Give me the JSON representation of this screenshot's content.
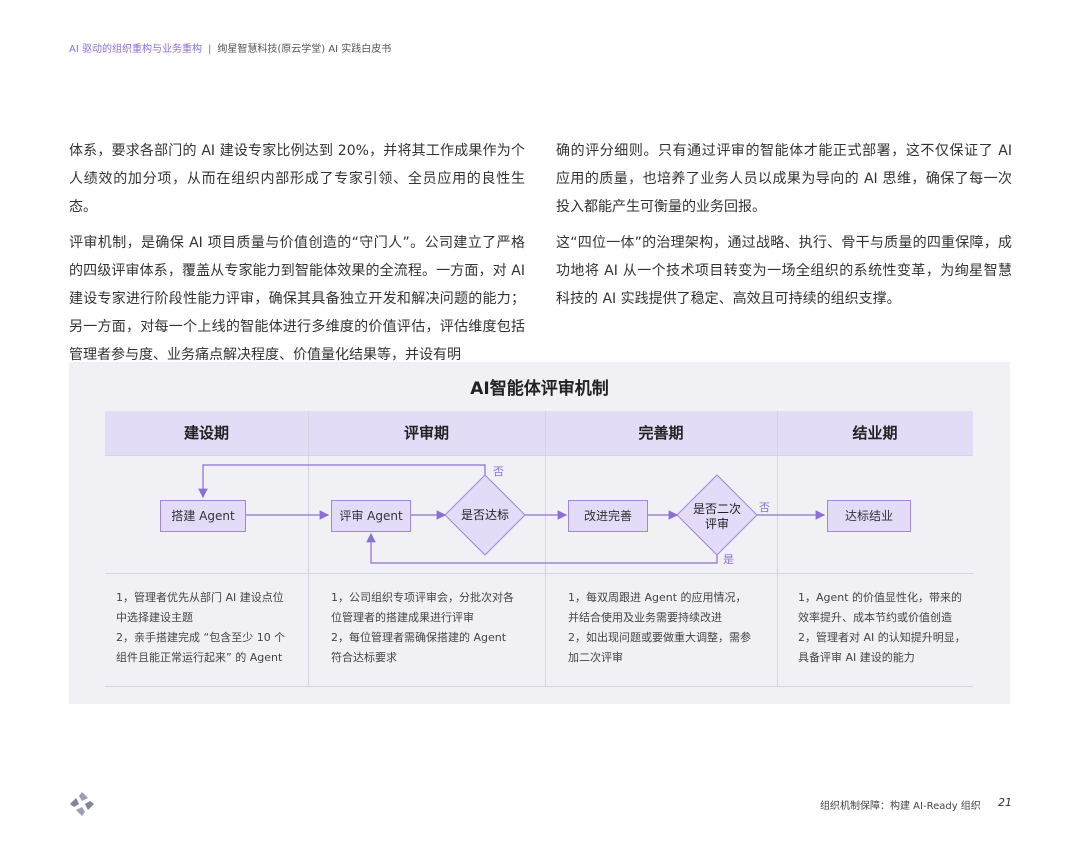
{
  "header": {
    "crumb": "AI 驱动的组织重构与业务重构",
    "separator": "|",
    "title": "绚星智慧科技(原云学堂) AI 实践白皮书"
  },
  "body": {
    "left_paragraphs": [
      "体系，要求各部门的 AI 建设专家比例达到 20%，并将其工作成果作为个人绩效的加分项，从而在组织内部形成了专家引领、全员应用的良性生态。",
      "评审机制，是确保 AI 项目质量与价值创造的“守门人”。公司建立了严格的四级评审体系，覆盖从专家能力到智能体效果的全流程。一方面，对 AI 建设专家进行阶段性能力评审，确保其具备独立开发和解决问题的能力；另一方面，对每一个上线的智能体进行多维度的价值评估，评估维度包括管理者参与度、业务痛点解决程度、价值量化结果等，并设有明"
    ],
    "right_paragraphs": [
      "确的评分细则。只有通过评审的智能体才能正式部署，这不仅保证了 AI 应用的质量，也培养了业务人员以成果为导向的 AI 思维，确保了每一次投入都能产生可衡量的业务回报。",
      "这“四位一体”的治理架构，通过战略、执行、骨干与质量的四重保障，成功地将 AI 从一个技术项目转变为一场全组织的系统性变革，为绚星智慧科技的 AI 实践提供了稳定、高效且可持续的组织支撑。"
    ]
  },
  "diagram": {
    "title": "AI智能体评审机制",
    "phases": [
      "建设期",
      "评审期",
      "完善期",
      "结业期"
    ],
    "nodes": {
      "build": "搭建 Agent",
      "review": "评审 Agent",
      "pass_check": "是否达标",
      "improve": "改进完善",
      "second_review_line1": "是否二次",
      "second_review_line2": "评审",
      "graduate": "达标结业"
    },
    "labels": {
      "no_top": "否",
      "no_right": "否",
      "yes": "是"
    },
    "descriptions": [
      [
        "1，管理者优先从部门 AI 建设点位",
        "中选择建设主题",
        "2，亲手搭建完成 “包含至少 10 个",
        "组件且能正常运行起来” 的 Agent"
      ],
      [
        "1，公司组织专项评审会，分批次对各",
        "位管理者的搭建成果进行评审",
        "2，每位管理者需确保搭建的 Agent",
        "符合达标要求"
      ],
      [
        "1，每双周跟进 Agent 的应用情况，",
        "并结合使用及业务需要持续改进",
        "2，如出现问题或要做重大调整，需参",
        "加二次评审"
      ],
      [
        "1，Agent 的价值显性化，带来的",
        "效率提升、成本节约或价值创造",
        "2，管理者对 AI 的认知提升明显，",
        "具备评审 AI 建设的能力"
      ]
    ]
  },
  "footer": {
    "section": "组织机制保障：构建 AI-Ready 组织",
    "page": "21"
  },
  "colors": {
    "accent": "#8b6fd6",
    "phase_bg": "#e3dcf6",
    "panel_bg": "#f1f1f5"
  }
}
